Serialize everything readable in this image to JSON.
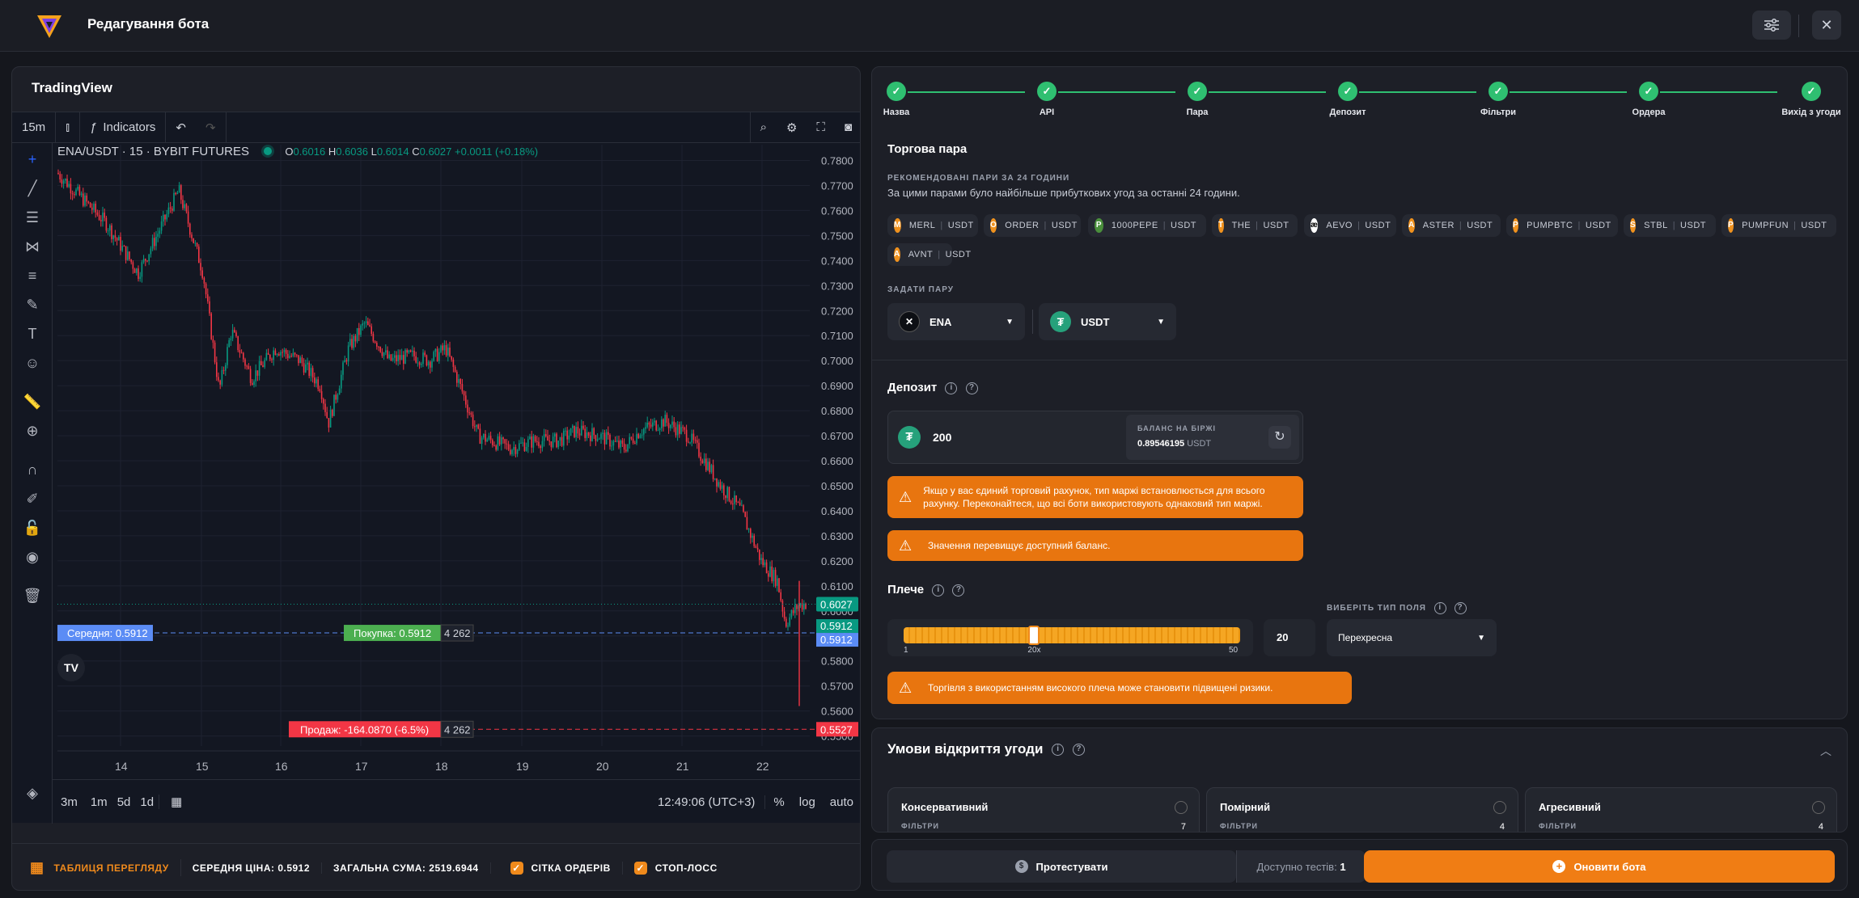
{
  "header": {
    "title": "Редагування бота"
  },
  "tv": {
    "panel_title": "TradingView",
    "interval": "15m",
    "indicators": "Indicators",
    "symbol": "ENA/USDT · 15 · BYBIT FUTURES",
    "ohlc": {
      "o": "0.6016",
      "h": "0.6036",
      "l": "0.6014",
      "c": "0.6027",
      "chg": "+0.0011 (+0.18%)"
    },
    "price_labels": [
      "0.7800",
      "0.7700",
      "0.7600",
      "0.7500",
      "0.7400",
      "0.7300",
      "0.7200",
      "0.7100",
      "0.7000",
      "0.6900",
      "0.6800",
      "0.6700",
      "0.6600",
      "0.6500",
      "0.6400",
      "0.6300",
      "0.6200",
      "0.6100",
      "0.6000",
      "0.5900",
      "0.5800",
      "0.5700",
      "0.5600",
      "0.5500"
    ],
    "date_labels": [
      "14",
      "15",
      "16",
      "17",
      "18",
      "19",
      "20",
      "21",
      "22"
    ],
    "current_price": "0.6027",
    "avg_price_tag": "0.5912",
    "buy_price_tag": "0.5912",
    "sell_price_tag": "0.5527",
    "avg_line": "Середня: 0.5912",
    "buy_line": "Покупка: 0.5912",
    "buy_qty": "4 262",
    "sell_line": "Продаж: -164.0870 (-6.5%)",
    "sell_qty": "4 262",
    "ranges": [
      "3m",
      "1m",
      "5d",
      "1d"
    ],
    "time": "12:49:06 (UTC+3)",
    "pct": "%",
    "log": "log",
    "auto": "auto"
  },
  "footer": {
    "table": "ТАБЛИЦЯ ПЕРЕГЛЯДУ",
    "avg_label": "СЕРЕДНЯ ЦІНА:",
    "avg_value": "0.5912",
    "sum_label": "ЗАГАЛЬНА СУМА:",
    "sum_value": "2519.6944",
    "grid": "СІТКА ОРДЕРІВ",
    "stop": "СТОП-ЛОСС"
  },
  "steps": [
    "Назва",
    "API",
    "Пара",
    "Депозит",
    "Фільтри",
    "Ордера",
    "Вихід з угоди"
  ],
  "pair": {
    "title": "Торгова пара",
    "rec_label": "РЕКОМЕНДОВАНІ ПАРИ ЗА 24 ГОДИНИ",
    "rec_desc": "За цими парами було найбільше прибуткових угод за останні 24 години.",
    "chips": [
      {
        "base": "MERL",
        "quote": "USDT",
        "ic": "M"
      },
      {
        "base": "ORDER",
        "quote": "USDT",
        "ic": "O"
      },
      {
        "base": "1000PEPE",
        "quote": "USDT",
        "ic": "P"
      },
      {
        "base": "THE",
        "quote": "USDT",
        "ic": "T"
      },
      {
        "base": "AEVO",
        "quote": "USDT",
        "ic": "æ"
      },
      {
        "base": "ASTER",
        "quote": "USDT",
        "ic": "A"
      },
      {
        "base": "PUMPBTC",
        "quote": "USDT",
        "ic": "P"
      },
      {
        "base": "STBL",
        "quote": "USDT",
        "ic": "S"
      },
      {
        "base": "PUMPFUN",
        "quote": "USDT",
        "ic": "P"
      },
      {
        "base": "AVNT",
        "quote": "USDT",
        "ic": "A"
      }
    ],
    "set_label": "ЗАДАТИ ПАРУ",
    "base": "ENA",
    "quote": "USDT"
  },
  "deposit": {
    "title": "Депозит",
    "amount": "200",
    "balance_label": "БАЛАНС НА БІРЖІ",
    "balance_value": "0.89546195",
    "balance_unit": "USDT",
    "warn1": "Якщо у вас єдиний торговий рахунок, тип маржі встановлюється для всього рахунку. Переконайтеся, що всі боти використовують однаковий тип маржі.",
    "warn2": "Значення перевищує доступний баланс."
  },
  "leverage": {
    "title": "Плече",
    "min": "1",
    "mid": "20x",
    "max": "50",
    "value": "20",
    "level": 0.388,
    "type_label": "ВИБЕРІТЬ ТИП ПОЛЯ",
    "type_value": "Перехресна",
    "warn": "Торгівля з використанням високого плеча може становити підвищені ризики."
  },
  "conditions": {
    "title": "Умови відкриття угоди",
    "cards": [
      {
        "name": "Консервативний",
        "sub": "ФІЛЬТРИ",
        "count": "7"
      },
      {
        "name": "Помірний",
        "sub": "ФІЛЬТРИ",
        "count": "4"
      },
      {
        "name": "Агресивний",
        "sub": "ФІЛЬТРИ",
        "count": "4"
      }
    ]
  },
  "actions": {
    "test": "Протестувати",
    "tests_label": "Доступно тестів:",
    "tests_value": "1",
    "update": "Оновити бота"
  },
  "colors": {
    "accent": "#f08a1c",
    "success": "#2fbf71",
    "up": "#089981",
    "down": "#f23645"
  }
}
